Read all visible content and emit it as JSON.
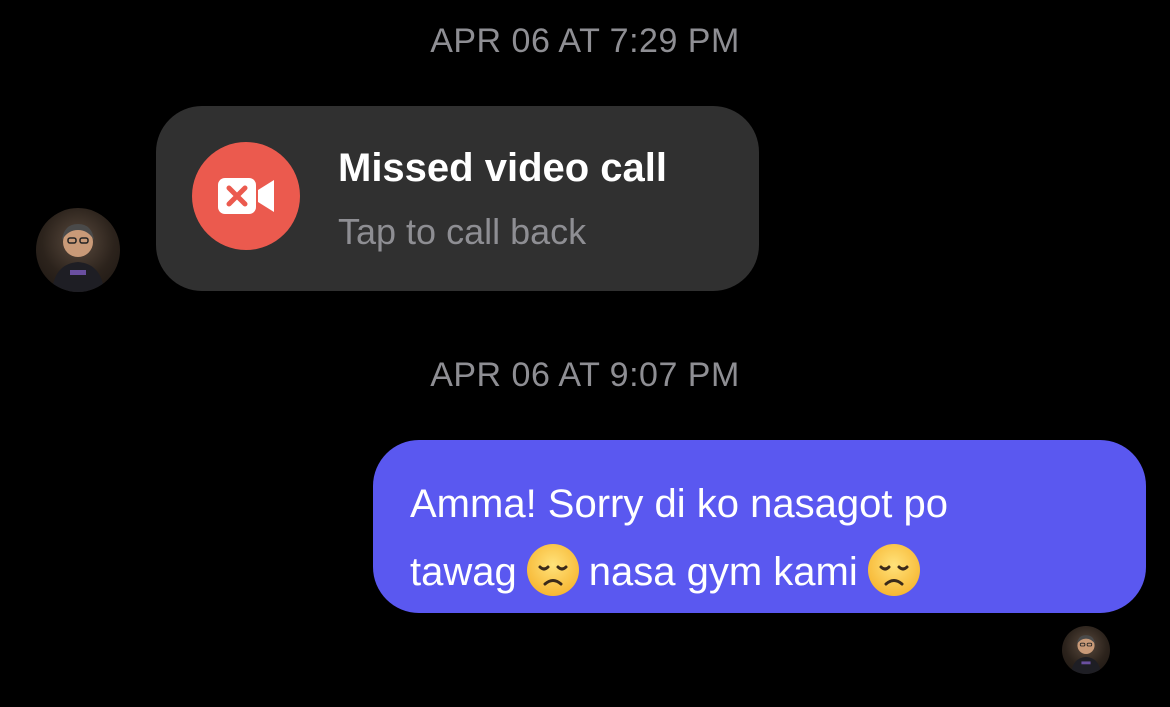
{
  "conversation": {
    "timestamps": [
      "APR 06 AT 7:29 PM",
      "APR 06 AT 9:07 PM"
    ],
    "missed_call": {
      "title": "Missed video call",
      "subtitle": "Tap to call back",
      "icon": "video-camera-x-icon",
      "icon_color": "#eb5a4e"
    },
    "sent_message": {
      "line1": "Amma! Sorry di ko nasagot po",
      "line2_part1": "tawag",
      "line2_part2": "nasa gym kami",
      "emoji": "disappointed-face-icon",
      "bubble_color": "#5a58f0"
    }
  },
  "colors": {
    "background": "#000000",
    "incoming_bubble": "#303030",
    "secondary_text": "#8e8e93"
  }
}
